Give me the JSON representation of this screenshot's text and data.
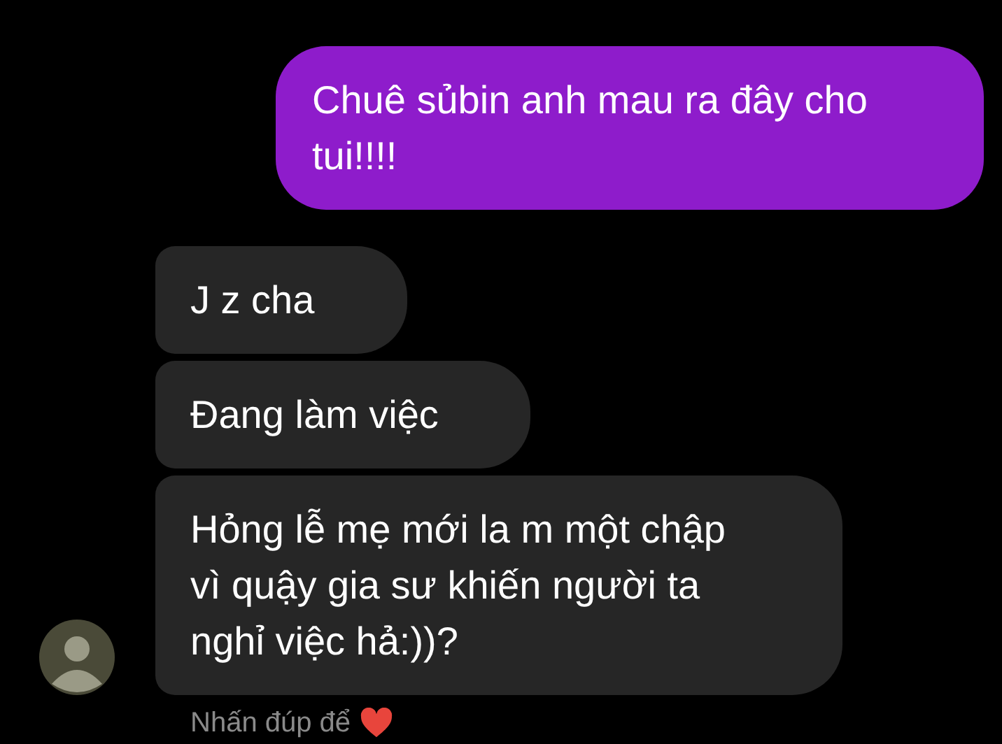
{
  "messages": [
    {
      "kind": "sent",
      "text": "Chuê sủbin anh mau ra đây cho tui!!!!"
    },
    {
      "kind": "received",
      "text": "J z cha"
    },
    {
      "kind": "received",
      "text": "Đang làm việc"
    },
    {
      "kind": "received",
      "text": "Hỏng lễ mẹ mới la m một chập vì quậy gia sư khiến người ta nghỉ việc hả:))?"
    }
  ],
  "footer": {
    "hint": "Nhấn đúp để"
  }
}
